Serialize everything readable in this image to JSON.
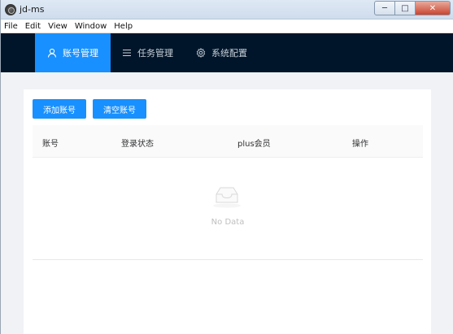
{
  "window": {
    "title": "jd-ms",
    "controls": {
      "minimize": "─",
      "maximize": "□",
      "close": "✕"
    }
  },
  "menubar": [
    "File",
    "Edit",
    "View",
    "Window",
    "Help"
  ],
  "nav": {
    "items": [
      {
        "label": "账号管理",
        "icon": "user-icon",
        "active": true
      },
      {
        "label": "任务管理",
        "icon": "list-icon",
        "active": false
      },
      {
        "label": "系统配置",
        "icon": "gear-icon",
        "active": false
      }
    ]
  },
  "toolbar": {
    "add_label": "添加账号",
    "clear_label": "清空账号"
  },
  "table": {
    "columns": [
      "账号",
      "登录状态",
      "plus会员",
      "操作"
    ],
    "rows": [],
    "empty_text": "No Data"
  },
  "colors": {
    "nav_bg": "#001529",
    "accent": "#1890ff",
    "content_bg": "#f0f2f5"
  }
}
